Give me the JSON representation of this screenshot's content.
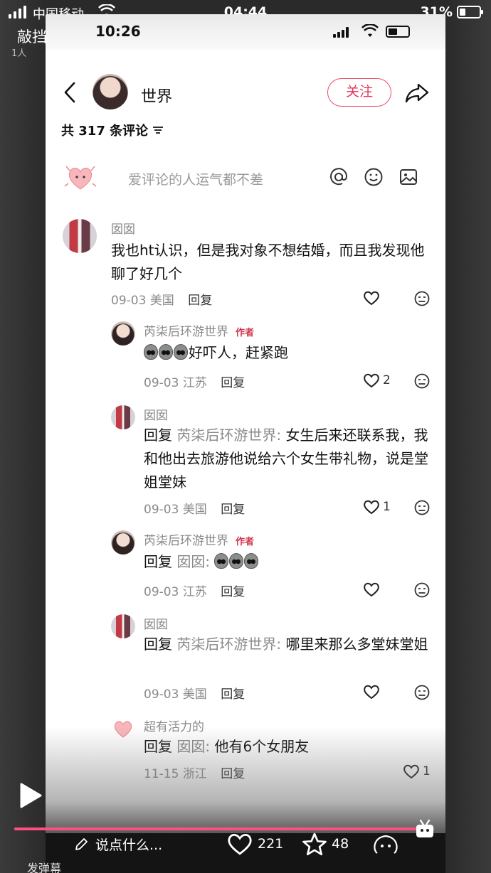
{
  "outer_status": {
    "carrier": "中国移动",
    "time": "04:44",
    "battery": "31%"
  },
  "outer_app": {
    "title": "敲挡",
    "subtitle": "1人"
  },
  "inner_status": {
    "time": "10:26"
  },
  "header": {
    "name": "世界",
    "follow_label": "关注"
  },
  "comments_count": "共 317 条评论",
  "input": {
    "placeholder": "爱评论的人运气都不差"
  },
  "comments": [
    {
      "user": "囡囡",
      "text": "我也ht认识，但是我对象不想结婚，而且我发现他聊了好几个",
      "date": "09-03",
      "location": "美国",
      "reply_label": "回复",
      "likes": ""
    },
    {
      "user": "芮柒后环游世界",
      "tag": "作者",
      "text": "好吓人，赶紧跑",
      "date": "09-03",
      "location": "江苏",
      "reply_label": "回复",
      "likes": "2"
    },
    {
      "user": "囡囡",
      "reply_prefix": "回复",
      "reply_to": "芮柒后环游世界",
      "text": "女生后来还联系我，我和他出去旅游他说给六个女生带礼物，说是堂姐堂妹",
      "date": "09-03",
      "location": "美国",
      "reply_label": "回复",
      "likes": "1"
    },
    {
      "user": "芮柒后环游世界",
      "tag": "作者",
      "reply_prefix": "回复",
      "reply_to": "囡囡",
      "date": "09-03",
      "location": "江苏",
      "reply_label": "回复",
      "likes": ""
    },
    {
      "user": "囡囡",
      "reply_prefix": "回复",
      "reply_to": "芮柒后环游世界",
      "text": "哪里来那么多堂妹堂姐",
      "date": "09-03",
      "location": "美国",
      "reply_label": "回复",
      "likes": ""
    },
    {
      "user": "超有活力的",
      "reply_prefix": "回复",
      "reply_to": "囡囡",
      "text": "他有6个女朋友",
      "date": "11-15",
      "location": "浙江",
      "reply_label": "回复",
      "likes": "1"
    }
  ],
  "bottom_bar": {
    "input_placeholder": "说点什么...",
    "likes": "221",
    "favorites": "48",
    "danmu_label": "发弹幕",
    "progress": 0.98
  },
  "colors": {
    "accent": "#e8365a",
    "progress": "#ff4f7e"
  },
  "icons": [
    "back-icon",
    "share-icon",
    "sort-icon",
    "at-icon",
    "emoji-icon",
    "image-icon",
    "heart-icon",
    "dislike-icon",
    "star-icon",
    "play-icon",
    "pencil-icon",
    "tv-icon"
  ]
}
